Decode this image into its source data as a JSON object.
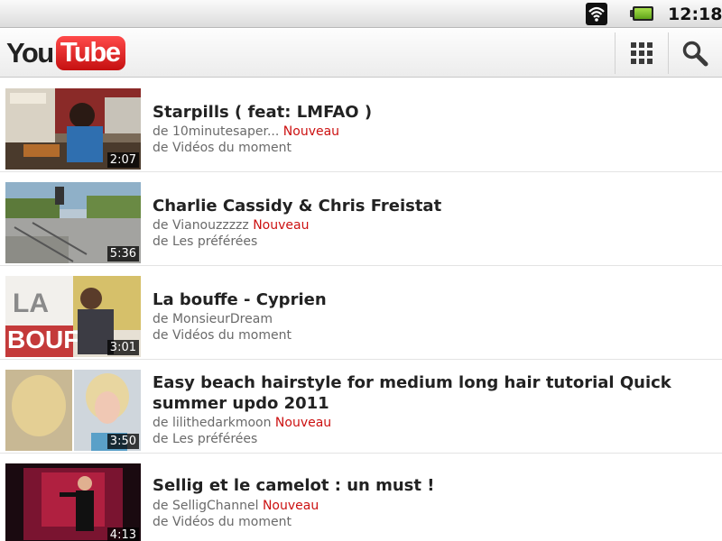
{
  "statusbar": {
    "time": "12:18"
  },
  "app": {
    "logo_you": "You",
    "logo_tube": "Tube"
  },
  "videos": [
    {
      "title": "Starpills ( feat: LMFAO )",
      "uploader": "de 10minutesaper...",
      "badge": "Nouveau",
      "category": "de Vidéos du moment",
      "duration": "2:07"
    },
    {
      "title": "Charlie Cassidy & Chris Freistat",
      "uploader": "de Vianouzzzzz",
      "badge": "Nouveau",
      "category": "de Les préférées",
      "duration": "5:36"
    },
    {
      "title": "La bouffe - Cyprien",
      "uploader": "de MonsieurDream",
      "badge": "",
      "category": "de Vidéos du moment",
      "duration": "3:01"
    },
    {
      "title": "Easy beach hairstyle for medium long hair tutorial Quick summer updo 2011",
      "uploader": "de lilithedarkmoon",
      "badge": "Nouveau",
      "category": "de Les préférées",
      "duration": "3:50"
    },
    {
      "title": "Sellig et le camelot : un must !",
      "uploader": "de SelligChannel",
      "badge": "Nouveau",
      "category": "de Vidéos du moment",
      "duration": "4:13"
    }
  ],
  "colors": {
    "accent_red": "#cc1111",
    "logo_red": "#e02020"
  },
  "icons": {
    "wifi": "wifi-icon",
    "battery": "battery-icon",
    "grid": "grid-icon",
    "search": "search-icon"
  }
}
